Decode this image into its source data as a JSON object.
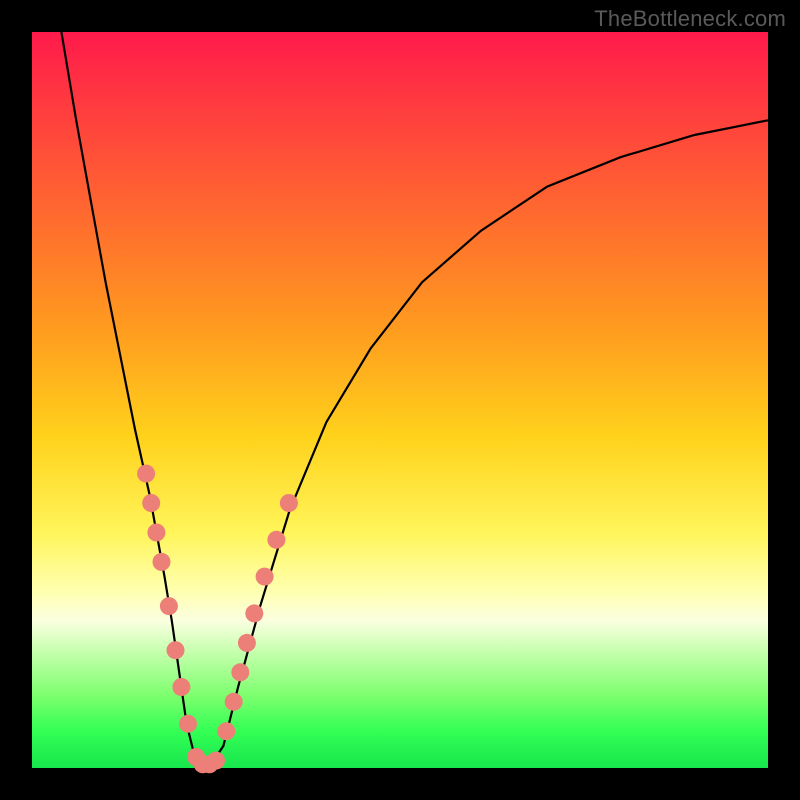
{
  "watermark": "TheBottleneck.com",
  "colors": {
    "frame": "#000000",
    "curve": "#000000",
    "beads": "#ec7f78",
    "gradient_top": "#ff1a4b",
    "gradient_bottom": "#17e64d"
  },
  "chart_data": {
    "type": "line",
    "title": "",
    "xlabel": "",
    "ylabel": "",
    "xlim": [
      0,
      100
    ],
    "ylim": [
      0,
      100
    ],
    "grid": false,
    "legend": false,
    "annotations": [
      "TheBottleneck.com"
    ],
    "series": [
      {
        "name": "bottleneck-curve",
        "x": [
          4,
          6,
          8,
          10,
          12,
          14,
          16,
          18,
          19,
          20,
          21,
          22,
          23,
          24,
          26,
          28,
          31,
          35,
          40,
          46,
          53,
          61,
          70,
          80,
          90,
          100
        ],
        "y": [
          100,
          88,
          77,
          66,
          56,
          46,
          37,
          26,
          20,
          13,
          6,
          2,
          0,
          0,
          3,
          11,
          22,
          35,
          47,
          57,
          66,
          73,
          79,
          83,
          86,
          88
        ]
      }
    ],
    "markers": [
      {
        "name": "left-branch-beads",
        "points": [
          {
            "x": 15.5,
            "y": 40
          },
          {
            "x": 16.2,
            "y": 36
          },
          {
            "x": 16.9,
            "y": 32
          },
          {
            "x": 17.6,
            "y": 28
          },
          {
            "x": 18.6,
            "y": 22
          },
          {
            "x": 19.5,
            "y": 16
          },
          {
            "x": 20.3,
            "y": 11
          },
          {
            "x": 21.2,
            "y": 6
          }
        ]
      },
      {
        "name": "valley-beads",
        "points": [
          {
            "x": 22.3,
            "y": 1.5
          },
          {
            "x": 23.2,
            "y": 0.5
          },
          {
            "x": 24.1,
            "y": 0.5
          },
          {
            "x": 25.0,
            "y": 1.0
          }
        ]
      },
      {
        "name": "right-branch-beads",
        "points": [
          {
            "x": 26.4,
            "y": 5
          },
          {
            "x": 27.4,
            "y": 9
          },
          {
            "x": 28.3,
            "y": 13
          },
          {
            "x": 29.2,
            "y": 17
          },
          {
            "x": 30.2,
            "y": 21
          },
          {
            "x": 31.6,
            "y": 26
          },
          {
            "x": 33.2,
            "y": 31
          },
          {
            "x": 34.9,
            "y": 36
          }
        ]
      }
    ]
  }
}
